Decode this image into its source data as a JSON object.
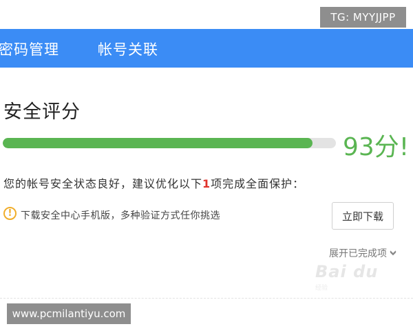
{
  "watermarks": {
    "tg": "TG: MYYJJPP",
    "url": "www.pcmilantiyu.com",
    "baidu": "Bai du",
    "baidu_sub": "经验"
  },
  "tabs": [
    {
      "label": "密码管理"
    },
    {
      "label": "帐号关联"
    }
  ],
  "security": {
    "title": "安全评分",
    "score_text": "93分!",
    "progress_percent": 93,
    "status_before": "您的帐号安全状态良好，建议优化以下",
    "status_count": "1",
    "status_after": "项完成全面保护："
  },
  "recommendation": {
    "icon": "warning-icon",
    "text": "下载安全中心手机版，多种验证方式任你挑选",
    "button_label": "立即下载"
  },
  "expand": {
    "label": "展开已完成项",
    "icon": "chevron-down-icon"
  },
  "colors": {
    "tab_bar": "#3b8cf5",
    "progress": "#5ab552",
    "highlight": "#e0322b",
    "warning": "#f0ad2a"
  }
}
